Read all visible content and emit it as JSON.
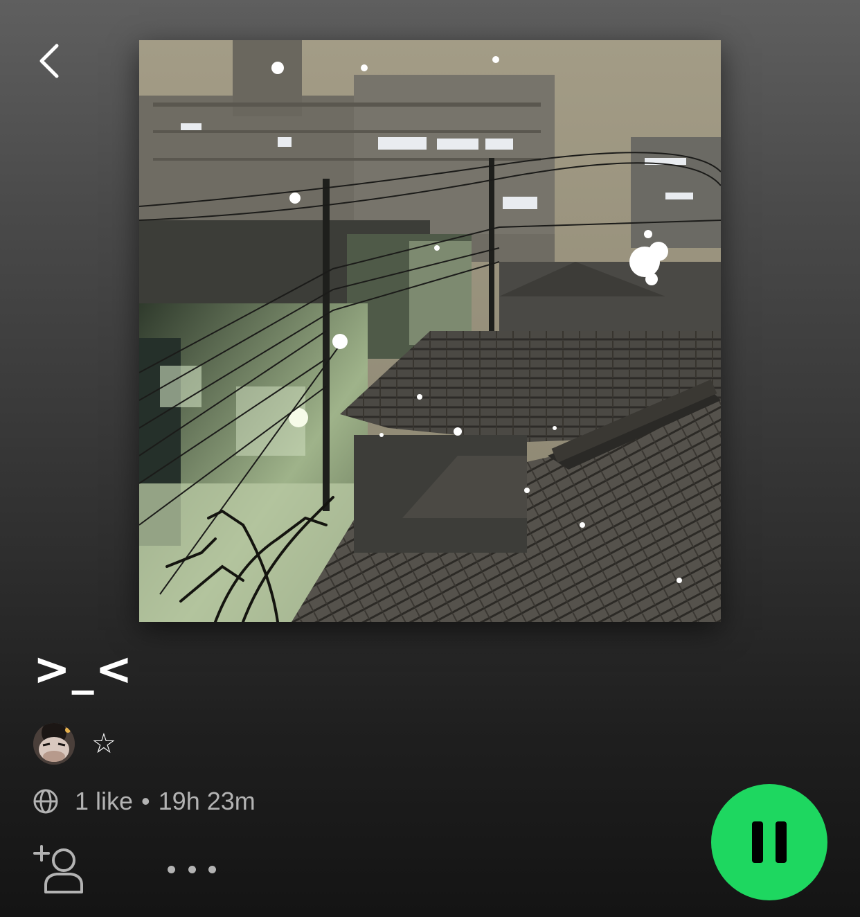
{
  "header": {
    "back_icon": "chevron-left-icon"
  },
  "playlist": {
    "title": ">_<",
    "owner_name": "☆",
    "meta": {
      "visibility_icon": "globe-icon",
      "likes": "1 like",
      "separator": "•",
      "duration": "19h 23m"
    }
  },
  "actions": {
    "add_user_icon": "add-user-icon",
    "more_icon": "more-options-icon",
    "play_state": "paused-icon-visible"
  },
  "colors": {
    "accent": "#1ed760",
    "secondary_text": "#b3b3b3"
  }
}
